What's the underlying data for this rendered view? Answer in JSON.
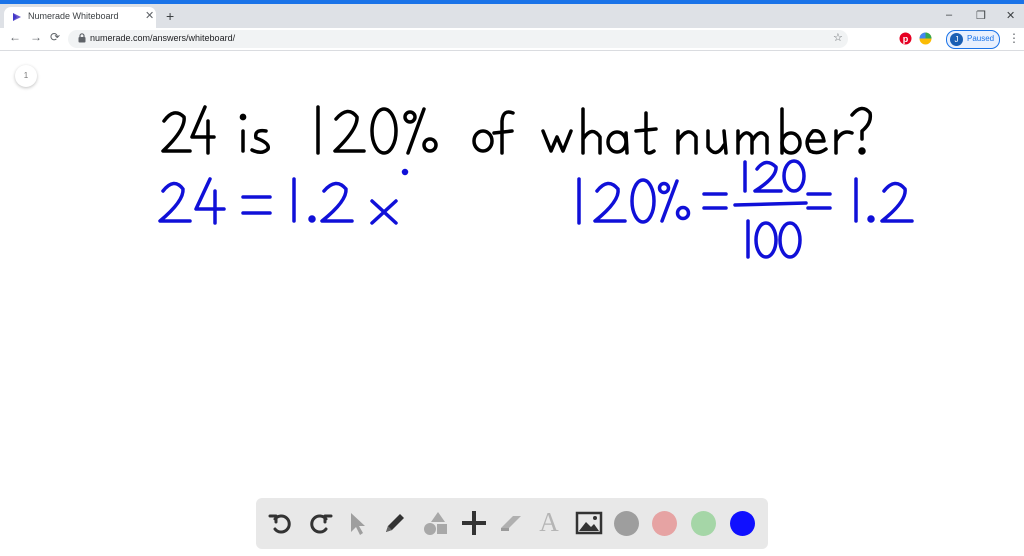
{
  "browser": {
    "tab_title": "Numerade Whiteboard",
    "tab_close": "✕",
    "new_tab": "+",
    "window_controls": {
      "minimize": "–",
      "restore": "❐",
      "close": "✕"
    },
    "nav": {
      "back": "←",
      "forward": "→",
      "reload": "⟳"
    },
    "url": "numerade.com/answers/whiteboard/",
    "bookmark": "☆",
    "profile": {
      "initial": "J",
      "status": "Paused"
    },
    "menu": "⋮"
  },
  "board": {
    "page_number": "1",
    "ink_black": "#000000",
    "ink_blue": "#1010d8",
    "question": "24 is 120% of what number?",
    "equation": "24 = 1.2x",
    "conversion": {
      "percent": "120%",
      "numerator": "120",
      "denominator": "100",
      "decimal": "1.2"
    }
  },
  "tools": {
    "icons": [
      "undo-icon",
      "redo-icon",
      "cursor-icon",
      "pen-icon",
      "shapes-icon",
      "add-icon",
      "eraser-icon",
      "text-icon",
      "image-icon"
    ],
    "text_glyph": "A",
    "colors": [
      "#9e9e9e",
      "#e6a3a3",
      "#a5d6a7",
      "#1010ff"
    ],
    "active_color": "#1010ff"
  }
}
